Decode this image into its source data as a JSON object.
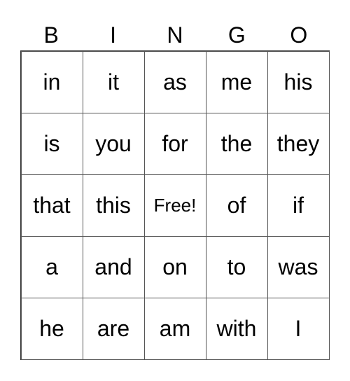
{
  "header": [
    "B",
    "I",
    "N",
    "G",
    "O"
  ],
  "cells": [
    [
      "in",
      "it",
      "as",
      "me",
      "his"
    ],
    [
      "is",
      "you",
      "for",
      "the",
      "they"
    ],
    [
      "that",
      "this",
      "Free!",
      "of",
      "if"
    ],
    [
      "a",
      "and",
      "on",
      "to",
      "was"
    ],
    [
      "he",
      "are",
      "am",
      "with",
      "I"
    ]
  ]
}
